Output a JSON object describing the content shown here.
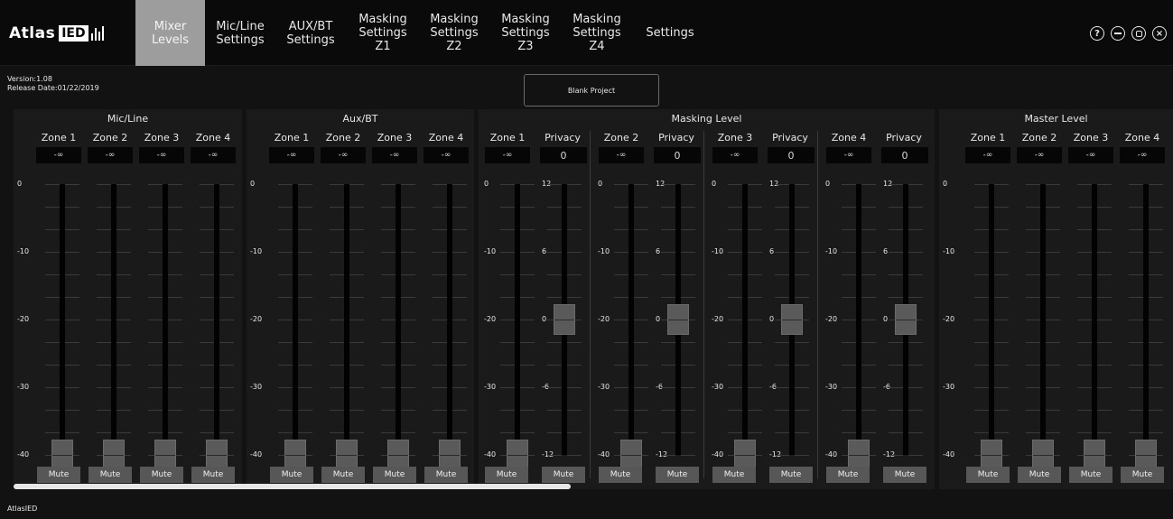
{
  "brand": {
    "name": "Atlas",
    "box": "IED"
  },
  "nav": [
    {
      "label": "Mixer Levels",
      "active": true
    },
    {
      "label": "Mic/Line\nSettings"
    },
    {
      "label": "AUX/BT\nSettings"
    },
    {
      "label": "Masking\nSettings\nZ1"
    },
    {
      "label": "Masking\nSettings\nZ2"
    },
    {
      "label": "Masking\nSettings\nZ3"
    },
    {
      "label": "Masking\nSettings\nZ4"
    },
    {
      "label": "Settings"
    }
  ],
  "window_controls": [
    {
      "name": "help-icon",
      "glyph": "?"
    },
    {
      "name": "minimize-icon",
      "glyph": "minus"
    },
    {
      "name": "maximize-icon",
      "glyph": "square"
    },
    {
      "name": "close-icon",
      "glyph": "×"
    }
  ],
  "info": {
    "version": "Version:1.08",
    "release": "Release Date:01/22/2019"
  },
  "project_button": "Blank Project",
  "panels": {
    "micline": {
      "title": "Mic/Line",
      "zones": [
        "Zone 1",
        "Zone 2",
        "Zone 3",
        "Zone 4"
      ],
      "readout": "-∞",
      "mute": "Mute",
      "scale": [
        "0",
        "-10",
        "-20",
        "-30",
        "-40"
      ],
      "fader_level_db": -40
    },
    "auxbt": {
      "title": "Aux/BT",
      "zones": [
        "Zone 1",
        "Zone 2",
        "Zone 3",
        "Zone 4"
      ],
      "readout": "-∞",
      "mute": "Mute",
      "scale": [
        "0",
        "-10",
        "-20",
        "-30",
        "-40"
      ],
      "fader_level_db": -40
    },
    "masking": {
      "title": "Masking Level",
      "level_scale": [
        "0",
        "-10",
        "-20",
        "-30",
        "-40"
      ],
      "privacy_scale": [
        "12",
        "6",
        "0",
        "-6",
        "-12"
      ],
      "zones": [
        {
          "label": "Zone 1",
          "privacy_label": "Privacy",
          "readout": "-∞",
          "privacy_value": "0",
          "level_db": -40,
          "privacy_db": 0
        },
        {
          "label": "Zone 2",
          "privacy_label": "Privacy",
          "readout": "-∞",
          "privacy_value": "0",
          "level_db": -40,
          "privacy_db": 0
        },
        {
          "label": "Zone 3",
          "privacy_label": "Privacy",
          "readout": "-∞",
          "privacy_value": "0",
          "level_db": -40,
          "privacy_db": 0
        },
        {
          "label": "Zone 4",
          "privacy_label": "Privacy",
          "readout": "-∞",
          "privacy_value": "0",
          "level_db": -40,
          "privacy_db": 0
        }
      ],
      "mute": "Mute"
    },
    "master": {
      "title": "Master Level",
      "zones": [
        "Zone 1",
        "Zone 2",
        "Zone 3",
        "Zone 4"
      ],
      "readout": "-∞",
      "mute": "Mute",
      "scale": [
        "0",
        "-10",
        "-20",
        "-30",
        "-40"
      ],
      "fader_level_db": -40
    }
  },
  "footer": "AtlasIED"
}
